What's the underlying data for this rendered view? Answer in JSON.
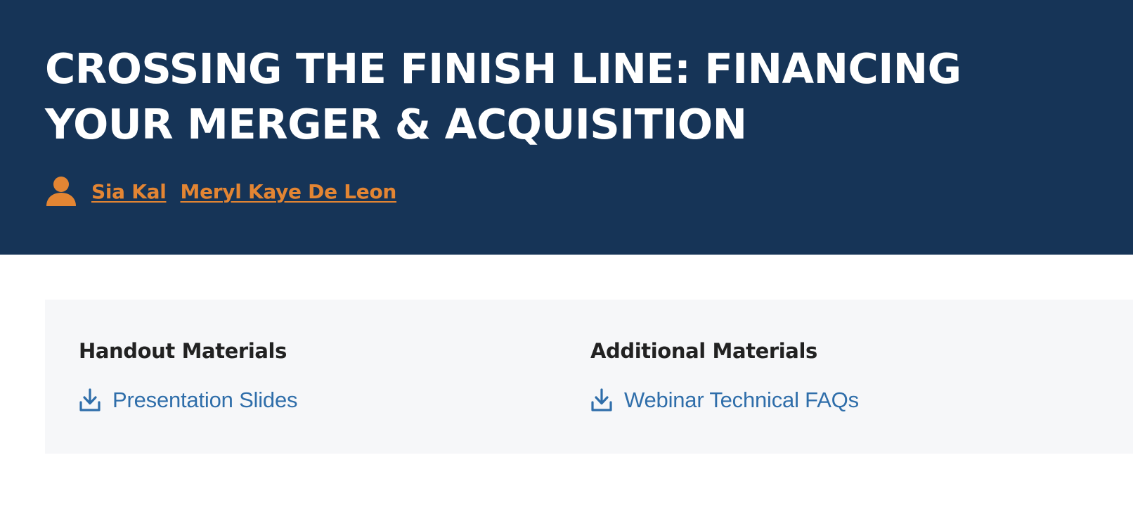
{
  "header": {
    "title": "CROSSING THE FINISH LINE: FINANCING YOUR MERGER & ACQUISITION",
    "authors_icon": "person-icon",
    "authors": [
      {
        "name": "Sia Kal"
      },
      {
        "name": "Meryl Kaye De Leon"
      }
    ]
  },
  "materials": {
    "handout": {
      "heading": "Handout Materials",
      "items": [
        {
          "label": "Presentation Slides",
          "icon": "download-icon"
        }
      ]
    },
    "additional": {
      "heading": "Additional Materials",
      "items": [
        {
          "label": "Webinar Technical FAQs",
          "icon": "download-icon"
        }
      ]
    }
  },
  "colors": {
    "hero_background": "#163457",
    "author_link": "#e38533",
    "panel_background": "#f6f7f9",
    "download_link": "#2f6eaa",
    "heading_text": "#222222"
  }
}
